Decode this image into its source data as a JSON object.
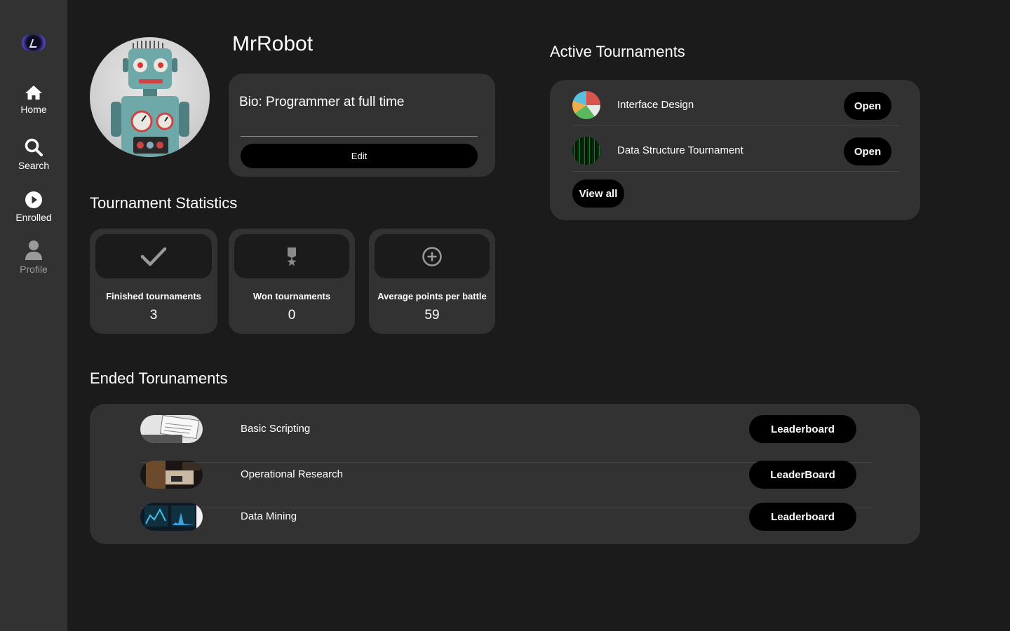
{
  "sidebar": {
    "logo": "app-logo",
    "items": [
      {
        "label": "Home",
        "icon": "home-icon"
      },
      {
        "label": "Search",
        "icon": "search-icon"
      },
      {
        "label": "Enrolled",
        "icon": "play-icon"
      },
      {
        "label": "Profile",
        "icon": "user-icon"
      }
    ]
  },
  "profile": {
    "username": "MrRobot",
    "bio": "Bio: Programmer at full time",
    "edit_label": "Edit"
  },
  "stats": {
    "title": "Tournament Statistics",
    "cards": [
      {
        "label": "Finished tournaments",
        "value": "3",
        "icon": "check-icon"
      },
      {
        "label": "Won tournaments",
        "value": "0",
        "icon": "medal-icon"
      },
      {
        "label": "Average points per battle",
        "value": "59",
        "icon": "plus-circle-icon"
      }
    ]
  },
  "active": {
    "title": "Active Tournaments",
    "items": [
      {
        "name": "Interface Design",
        "button": "Open"
      },
      {
        "name": "Data Structure Tournament",
        "button": "Open"
      }
    ],
    "view_all": "View all"
  },
  "ended": {
    "title": "Ended Torunaments",
    "items": [
      {
        "name": "Basic Scripting",
        "button": "Leaderboard"
      },
      {
        "name": "Operational Research",
        "button": "LeaderBoard"
      },
      {
        "name": "Data Mining",
        "button": "Leaderboard"
      }
    ]
  },
  "colors": {
    "background": "#1b1b1b",
    "panel": "#323232",
    "button": "#000000",
    "muted": "#9a9a9a"
  }
}
